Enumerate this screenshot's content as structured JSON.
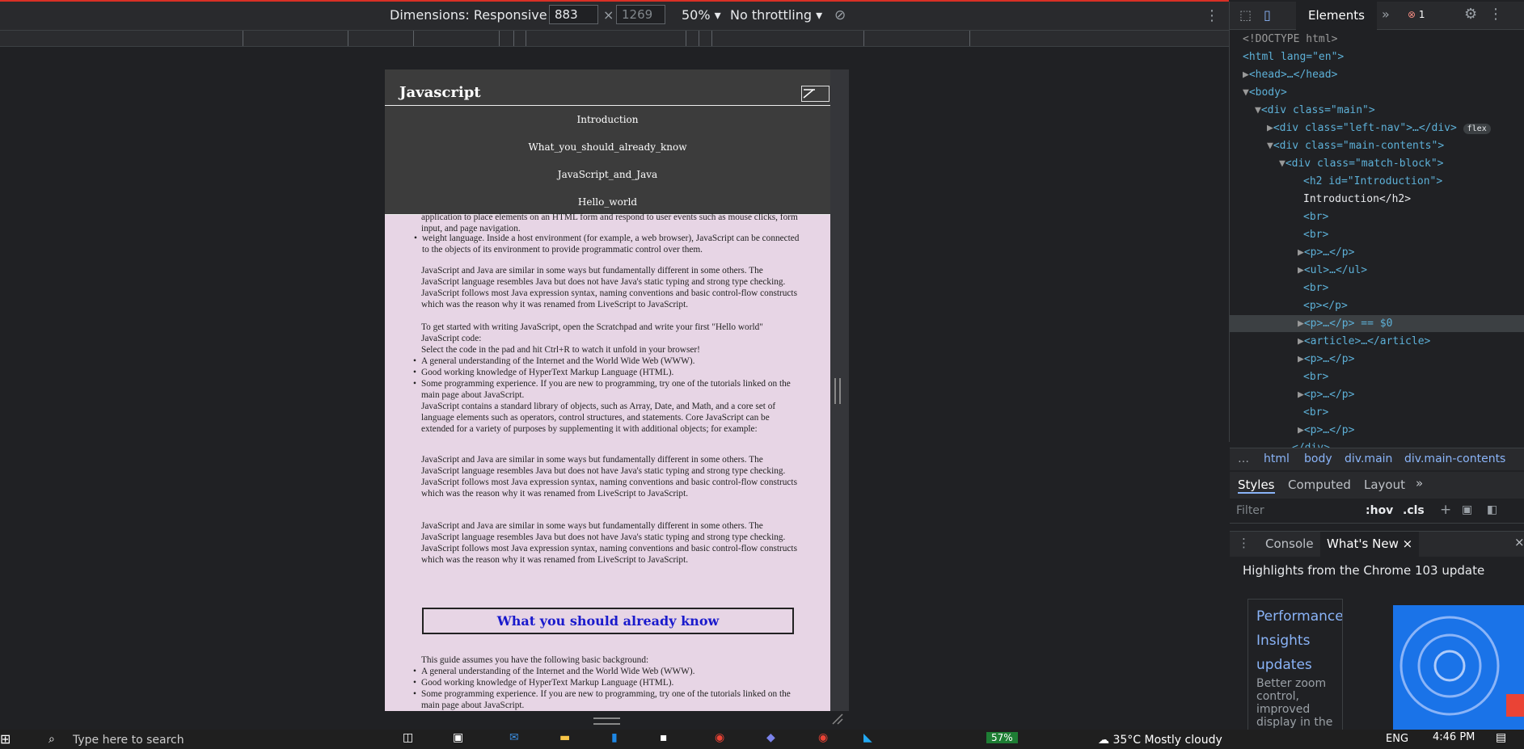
{
  "devtools_toolbar": {
    "dimensions_label": "Dimensions: Responsive",
    "width_value": "883",
    "height_placeholder": "1269",
    "zoom": "50%",
    "throttling": "No throttling"
  },
  "site": {
    "title": "Javascript",
    "nav_items": [
      "Introduction",
      "What_you_should_already_know",
      "JavaScript_and_Java",
      "Hello_world"
    ],
    "content": {
      "partial_line": "application to place elements on an HTML form and respond to user events such as mouse clicks, form input, and page navigation.",
      "bullet1": "weight language. Inside a host environment (for example, a web browser), JavaScript can be connected to the objects of its environment to provide programmatic control over them.",
      "para_js_java": "JavaScript and Java are similar in some ways but fundamentally different in some others. The JavaScript language resembles Java but does not have Java's static typing and strong type checking. JavaScript follows most Java expression syntax, naming conventions and basic control-flow constructs which was the reason why it was renamed from LiveScript to JavaScript.",
      "para_get_started": "To get started with writing JavaScript, open the Scratchpad and write your first \"Hello world\" JavaScript code:",
      "para_select": "Select the code in the pad and hit Ctrl+R to watch it unfold in your browser!",
      "li_internet": "A general understanding of the Internet and the World Wide Web (WWW).",
      "li_html": "Good working knowledge of HyperText Markup Language (HTML).",
      "li_programming": "Some programming experience. If you are new to programming, try one of the tutorials linked on the main page about JavaScript.",
      "para_stdlib": "JavaScript contains a standard library of objects, such as Array, Date, and Math, and a core set of language elements such as operators, control structures, and statements. Core JavaScript can be extended for a variety of purposes by supplementing it with additional objects; for example:",
      "heading_know": "What you should already know",
      "para_guide": "This guide assumes you have the following basic background:"
    }
  },
  "elements_panel": {
    "tab_label": "Elements",
    "error_count": "1",
    "dom_lines": [
      "<!DOCTYPE html>",
      "<html lang=\"en\">",
      "<head>…</head>",
      "<body>",
      "<div class=\"main\">",
      "<div class=\"left-nav\">…</div>",
      "<div class=\"main-contents\">",
      "<div class=\"match-block\">",
      "<h2 id=\"Introduction\">",
      "Introduction</h2>",
      "<br>",
      "<br>",
      "<p>…</p>",
      "<ul>…</ul>",
      "<br>",
      "<p></p>",
      "<p>…</p> == $0",
      "<article>…</article>",
      "<p>…</p>",
      "<br>",
      "<p>…</p>",
      "<br>",
      "<p>…</p>",
      "</div>"
    ],
    "flex_badge": "flex",
    "breadcrumbs": [
      "…",
      "html",
      "body",
      "div.main",
      "div.main-contents"
    ],
    "styles_tabs": [
      "Styles",
      "Computed",
      "Layout"
    ],
    "filter_placeholder": "Filter",
    "hov": ":hov",
    "cls": ".cls"
  },
  "drawer": {
    "tabs": [
      "Console",
      "What's New"
    ],
    "heading": "Highlights from the Chrome 103 update",
    "card_title": "Performance Insights updates",
    "card_desc": "Better zoom control, improved display in the"
  },
  "taskbar": {
    "search_placeholder": "Type here to search",
    "battery": "57%",
    "weather": "35°C  Mostly cloudy",
    "lang": "ENG",
    "time": "4:46 PM"
  }
}
